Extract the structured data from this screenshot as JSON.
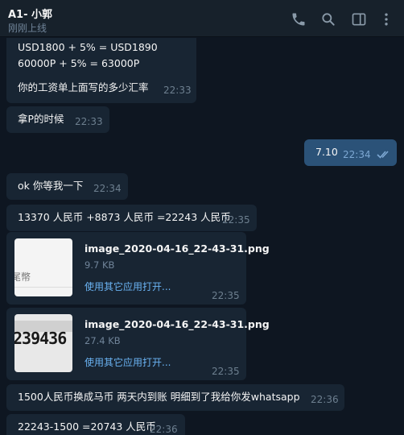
{
  "header": {
    "title": "A1- 小郭",
    "status": "刚刚上线",
    "icons": [
      "phone-icon",
      "search-icon",
      "sidebar-toggle-icon",
      "more-icon"
    ]
  },
  "messages": [
    {
      "id": "m1",
      "direction": "in",
      "lines": [
        "USD1800 + 5% = USD1890",
        "60000P + 5% = 63000P",
        "",
        "你的工资单上面写的多少汇率"
      ],
      "time": "22:33"
    },
    {
      "id": "m2",
      "direction": "in",
      "text": "拿P的时候",
      "time": "22:33"
    },
    {
      "id": "m3",
      "direction": "out",
      "text": "7.10",
      "time": "22:34",
      "read": true
    },
    {
      "id": "m4",
      "direction": "in",
      "text": "ok 你等我一下",
      "time": "22:34"
    },
    {
      "id": "m5",
      "direction": "in",
      "text": "13370 人民币 +8873 人民币 =22243 人民币",
      "time": "22:35"
    },
    {
      "id": "m6",
      "direction": "in",
      "type": "file",
      "thumb_text": "尾幣",
      "name": "image_2020-04-16_22-43-31.png",
      "size": "9.7 KB",
      "action": "使用其它应用打开...",
      "time": "22:35"
    },
    {
      "id": "m7",
      "direction": "in",
      "type": "file",
      "thumb_text": "239436",
      "name": "image_2020-04-16_22-43-31.png",
      "size": "27.4 KB",
      "action": "使用其它应用打开...",
      "time": "22:35"
    },
    {
      "id": "m8",
      "direction": "in",
      "text": "1500人民币换成马币 两天内到账 明细到了我给你发whatsapp",
      "time": "22:36"
    },
    {
      "id": "m9",
      "direction": "in",
      "text": "22243-1500 =20743 人民币",
      "time": "22:36"
    }
  ],
  "colors": {
    "background": "#0e1621",
    "incoming_bubble": "#182533",
    "outgoing_bubble": "#2b5278",
    "link": "#6ab3f3"
  }
}
